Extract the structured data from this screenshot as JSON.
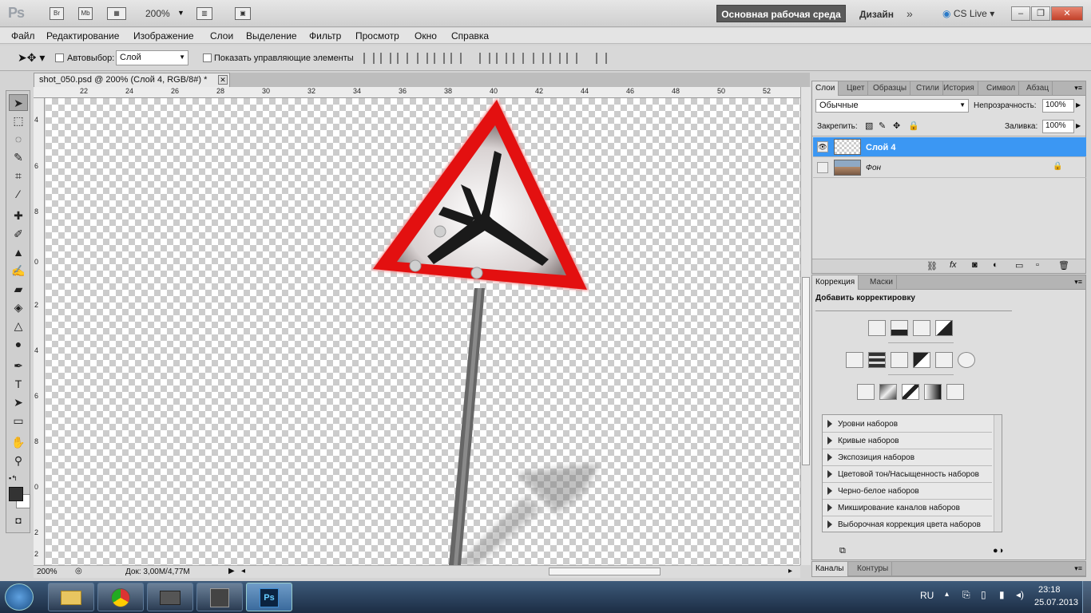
{
  "appbar": {
    "logo": "Ps",
    "btn_br": "Br",
    "btn_mb": "Mb",
    "zoom": "200%",
    "workspace": "Основная рабочая среда",
    "design": "Дизайн",
    "cslive": "CS Live"
  },
  "menu": [
    "Файл",
    "Редактирование",
    "Изображение",
    "Слои",
    "Выделение",
    "Фильтр",
    "Просмотр",
    "Окно",
    "Справка"
  ],
  "options": {
    "autoselect_label": "Автовыбор:",
    "autoselect_value": "Слой",
    "show_controls_label": "Показать управляющие элементы"
  },
  "document": {
    "tab_title": "shot_050.psd @ 200% (Слой 4, RGB/8#) *",
    "hruler_ticks": [
      "22",
      "24",
      "26",
      "28",
      "30",
      "32",
      "34",
      "36",
      "38",
      "40",
      "42",
      "44",
      "46",
      "48",
      "50",
      "52"
    ],
    "vruler_ticks": [
      "4",
      "6",
      "8",
      "0",
      "2",
      "4",
      "6",
      "8",
      "0",
      "2",
      "2"
    ],
    "status_zoom": "200%",
    "status_doc": "Док: 3,00M/4,77M"
  },
  "layers_panel": {
    "tabs": [
      "Слои",
      "Цвет",
      "Образцы",
      "Стили",
      "История",
      "Символ",
      "Абзац"
    ],
    "blend_mode": "Обычные",
    "opacity_label": "Непрозрачность:",
    "opacity_value": "100%",
    "lock_label": "Закрепить:",
    "fill_label": "Заливка:",
    "fill_value": "100%",
    "layers": [
      {
        "name": "Слой 4"
      },
      {
        "name": "Фон"
      }
    ]
  },
  "adjust_panel": {
    "tabs": [
      "Коррекция",
      "Маски"
    ],
    "title": "Добавить корректировку",
    "presets": [
      "Уровни наборов",
      "Кривые наборов",
      "Экспозиция наборов",
      "Цветовой тон/Насыщенность наборов",
      "Черно-белое наборов",
      "Микширование каналов наборов",
      "Выборочная коррекция цвета наборов"
    ]
  },
  "channels_panel": {
    "tabs": [
      "Каналы",
      "Контуры"
    ]
  },
  "taskbar": {
    "lang": "RU",
    "time": "23:18",
    "date": "25.07.2013",
    "ps_label": "Ps"
  },
  "colors": {
    "accent": "#3b97f3",
    "sign_red": "#e31010"
  }
}
